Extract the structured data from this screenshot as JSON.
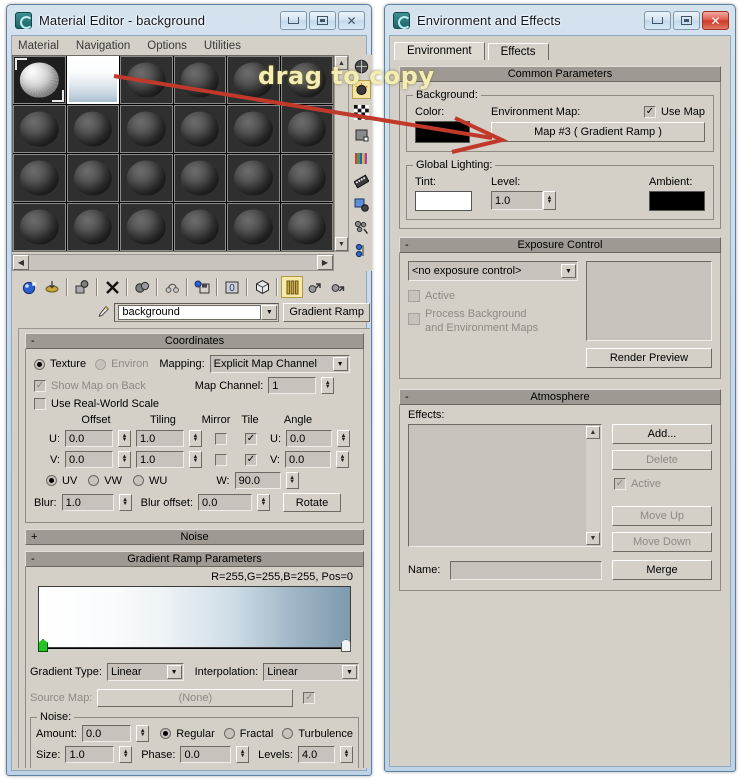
{
  "annotation": {
    "text": "drag to copy",
    "color": "#f5eeb4",
    "arrow_color": "#c0392b"
  },
  "material_editor": {
    "title": "Material Editor - background",
    "window_buttons": {
      "minimize": "minimize-icon",
      "maximize": "maximize-icon",
      "close": "close-icon"
    },
    "menu": [
      "Material",
      "Navigation",
      "Options",
      "Utilities"
    ],
    "slots": {
      "columns": 6,
      "rows": 4,
      "active_index": 1,
      "items": [
        {
          "type": "noise-texture",
          "label": "slot-1"
        },
        {
          "type": "gradient",
          "label": "slot-2"
        },
        {
          "type": "sphere",
          "label": "slot-3"
        },
        {
          "type": "sphere",
          "label": "slot-4"
        },
        {
          "type": "sphere",
          "label": "slot-5"
        },
        {
          "type": "sphere",
          "label": "slot-6"
        },
        {
          "type": "sphere",
          "label": "slot-7"
        },
        {
          "type": "sphere",
          "label": "slot-8"
        },
        {
          "type": "sphere",
          "label": "slot-9"
        },
        {
          "type": "sphere",
          "label": "slot-10"
        },
        {
          "type": "sphere",
          "label": "slot-11"
        },
        {
          "type": "sphere",
          "label": "slot-12"
        },
        {
          "type": "sphere",
          "label": "slot-13"
        },
        {
          "type": "sphere",
          "label": "slot-14"
        },
        {
          "type": "sphere",
          "label": "slot-15"
        },
        {
          "type": "sphere",
          "label": "slot-16"
        },
        {
          "type": "sphere",
          "label": "slot-17"
        },
        {
          "type": "sphere",
          "label": "slot-18"
        },
        {
          "type": "sphere",
          "label": "slot-19"
        },
        {
          "type": "sphere",
          "label": "slot-20"
        },
        {
          "type": "sphere",
          "label": "slot-21"
        },
        {
          "type": "sphere",
          "label": "slot-22"
        },
        {
          "type": "sphere",
          "label": "slot-23"
        },
        {
          "type": "sphere",
          "label": "slot-24"
        }
      ]
    },
    "vertical_toolbar": [
      {
        "icon": "sample-type-sphere-icon"
      },
      {
        "icon": "backlight-icon",
        "active": true
      },
      {
        "icon": "background-checker-icon"
      },
      {
        "icon": "sample-uv-tiling-icon"
      },
      {
        "icon": "video-color-check-icon"
      },
      {
        "icon": "make-preview-icon"
      },
      {
        "icon": "options-icon"
      },
      {
        "icon": "select-by-material-icon"
      },
      {
        "icon": "material-id-channel-icon"
      }
    ],
    "toolbar": [
      {
        "icon": "get-material-icon"
      },
      {
        "icon": "put-material-to-scene-icon"
      },
      {
        "icon": "assign-material-to-selection-icon"
      },
      {
        "icon": "reset-map-material-icon"
      },
      {
        "icon": "make-material-copy-icon"
      },
      {
        "icon": "make-unique-icon"
      },
      {
        "icon": "put-to-library-icon"
      },
      {
        "icon": "material-effects-channel-icon"
      },
      {
        "icon": "show-map-in-viewport-icon"
      },
      {
        "icon": "show-end-result-icon",
        "active": true
      },
      {
        "icon": "go-to-parent-icon"
      },
      {
        "icon": "go-forward-to-sibling-icon"
      }
    ],
    "name_row": {
      "eyedropper_icon": "eyedropper-icon",
      "material_name": "background",
      "map_type_button": "Gradient Ramp"
    },
    "coordinates": {
      "rollout_title": "Coordinates",
      "expand_marker": "-",
      "texture_label": "Texture",
      "texture_selected": true,
      "environ_label": "Environ",
      "mapping_label": "Mapping:",
      "mapping_value": "Explicit Map Channel",
      "show_map_on_back_label": "Show Map on Back",
      "show_map_on_back_checked": true,
      "show_map_on_back_disabled": true,
      "map_channel_label": "Map Channel:",
      "map_channel_value": "1",
      "use_real_world_scale_label": "Use Real-World Scale",
      "use_real_world_scale_checked": false,
      "col_offset": "Offset",
      "col_tiling": "Tiling",
      "col_mirror": "Mirror",
      "col_tile": "Tile",
      "col_angle": "Angle",
      "rows": [
        {
          "axis": "U:",
          "offset": "0.0",
          "tiling": "1.0",
          "mirror": false,
          "tile": true,
          "angle_axis": "U:",
          "angle": "0.0"
        },
        {
          "axis": "V:",
          "offset": "0.0",
          "tiling": "1.0",
          "mirror": false,
          "tile": true,
          "angle_axis": "V:",
          "angle": "0.0"
        }
      ],
      "w_axis": "W:",
      "w_value": "90.0",
      "uv_label": "UV",
      "vw_label": "VW",
      "wu_label": "WU",
      "uvw_selected": "UV",
      "blur_label": "Blur:",
      "blur_value": "1.0",
      "blur_offset_label": "Blur offset:",
      "blur_offset_value": "0.0",
      "rotate_button": "Rotate"
    },
    "noise_rollout": {
      "title": "Noise",
      "expand_marker": "+"
    },
    "gradient_ramp": {
      "rollout_title": "Gradient Ramp Parameters",
      "expand_marker": "-",
      "readout": "R=255,G=255,B=255, Pos=0",
      "gradient_start_color": "#ffffff",
      "gradient_end_color": "#7e9aae",
      "flags": [
        {
          "position_pct": 0,
          "color": "#25c425",
          "name": "gradient-flag-start"
        },
        {
          "position_pct": 100,
          "color": "#f2f2f2",
          "name": "gradient-flag-end"
        }
      ],
      "gradient_type_label": "Gradient Type:",
      "gradient_type_value": "Linear",
      "interpolation_label": "Interpolation:",
      "interpolation_value": "Linear",
      "source_map_label": "Source Map:",
      "source_map_value": "(None)",
      "source_map_checked": true,
      "noise_group_label": "Noise:",
      "amount_label": "Amount:",
      "amount_value": "0.0",
      "regular_label": "Regular",
      "fractal_label": "Fractal",
      "turbulence_label": "Turbulence",
      "noise_type_selected": "Regular",
      "size_label": "Size:",
      "size_value": "1.0",
      "phase_label": "Phase:",
      "phase_value": "0.0",
      "levels_label": "Levels:",
      "levels_value": "4.0"
    }
  },
  "environment_effects": {
    "title": "Environment and Effects",
    "tabs": [
      {
        "label": "Environment",
        "active": true
      },
      {
        "label": "Effects",
        "active": false
      }
    ],
    "common_parameters": {
      "rollout_title": "Common Parameters",
      "expand_marker": "-",
      "background_group": "Background:",
      "color_label": "Color:",
      "color_value": "#000000",
      "environment_map_label": "Environment Map:",
      "use_map_label": "Use Map",
      "use_map_checked": true,
      "map_button_label": "Map #3  ( Gradient Ramp )",
      "global_lighting_group": "Global Lighting:",
      "tint_label": "Tint:",
      "tint_value": "#ffffff",
      "level_label": "Level:",
      "level_value": "1.0",
      "ambient_label": "Ambient:",
      "ambient_value": "#000000"
    },
    "exposure_control": {
      "rollout_title": "Exposure Control",
      "expand_marker": "-",
      "selected_control": "<no exposure control>",
      "active_label": "Active",
      "active_checked": false,
      "active_disabled": true,
      "process_bg_label_line1": "Process Background",
      "process_bg_label_line2": "and Environment Maps",
      "process_bg_checked": false,
      "process_bg_disabled": true,
      "render_preview_button": "Render Preview"
    },
    "atmosphere": {
      "rollout_title": "Atmosphere",
      "expand_marker": "-",
      "effects_label": "Effects:",
      "effects_items": [],
      "add_button": "Add...",
      "delete_button": "Delete",
      "active_label": "Active",
      "active_checked": true,
      "move_up_button": "Move Up",
      "move_down_button": "Move Down",
      "name_label": "Name:",
      "name_value": "",
      "merge_button": "Merge"
    }
  }
}
